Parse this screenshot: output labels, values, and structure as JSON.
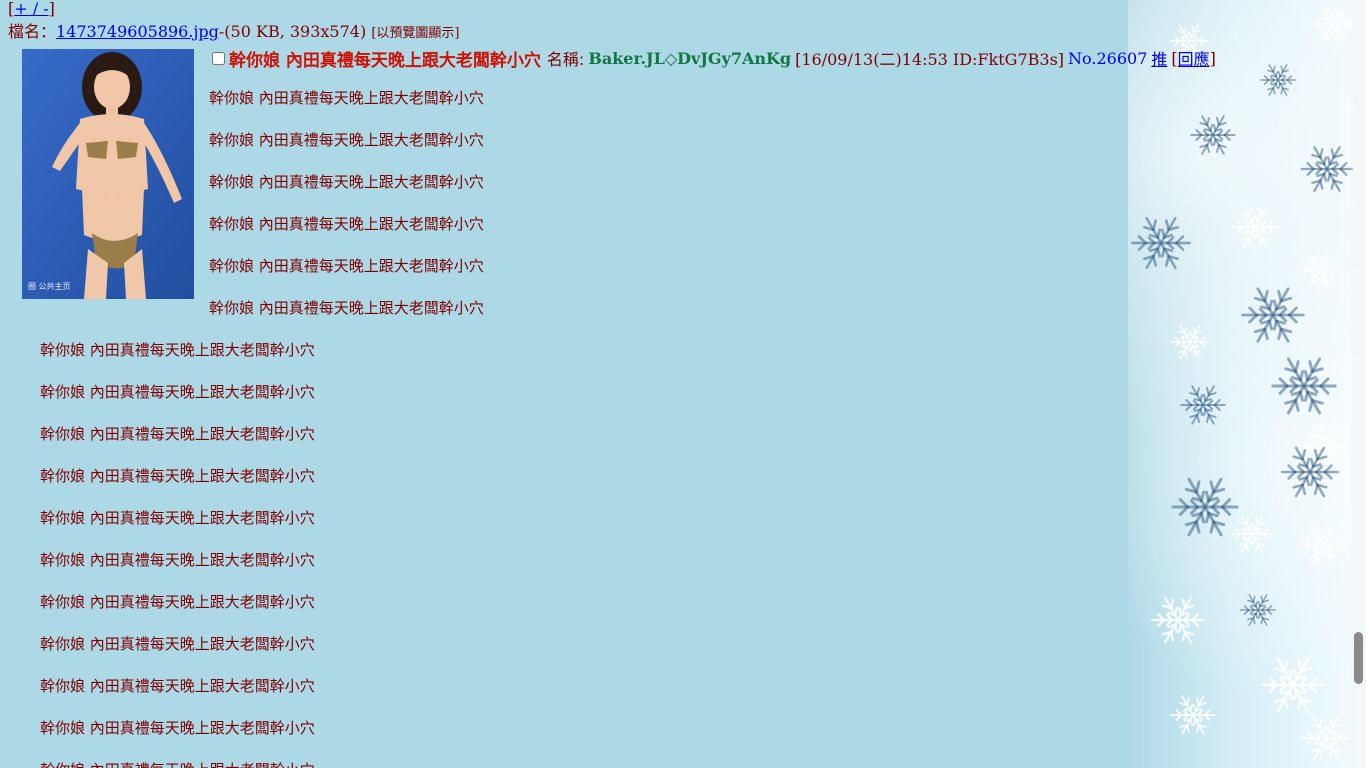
{
  "nav": {
    "toggle_open": "[",
    "toggle_link": "+ / -",
    "toggle_close": "]"
  },
  "file": {
    "label": "檔名：",
    "filename": "1473749605896.jpg",
    "info": "-(50 KB, 393x574)",
    "preview_note": "[以預覽圖顯示]"
  },
  "post": {
    "title": "幹你娘 內田真禮每天晚上跟大老闆幹小穴",
    "name_label": "名稱:",
    "poster_name": "Baker.JL◇DvJGy7AnKg",
    "meta": "[16/09/13(二)14:53 ID:FktG7B3s]",
    "number": "No.26607",
    "push_label": "推",
    "reply_open": "[",
    "reply_label": "回應",
    "reply_close": "]"
  },
  "body_lines": [
    "幹你娘 內田真禮每天晚上跟大老闆幹小穴",
    "幹你娘 內田真禮每天晚上跟大老闆幹小穴",
    "幹你娘 內田真禮每天晚上跟大老闆幹小穴",
    "幹你娘 內田真禮每天晚上跟大老闆幹小穴",
    "幹你娘 內田真禮每天晚上跟大老闆幹小穴",
    "幹你娘 內田真禮每天晚上跟大老闆幹小穴",
    "幹你娘 內田真禮每天晚上跟大老闆幹小穴",
    "幹你娘 內田真禮每天晚上跟大老闆幹小穴",
    "幹你娘 內田真禮每天晚上跟大老闆幹小穴",
    "幹你娘 內田真禮每天晚上跟大老闆幹小穴",
    "幹你娘 內田真禮每天晚上跟大老闆幹小穴",
    "幹你娘 內田真禮每天晚上跟大老闆幹小穴",
    "幹你娘 內田真禮每天晚上跟大老闆幹小穴",
    "幹你娘 內田真禮每天晚上跟大老闆幹小穴",
    "幹你娘 內田真禮每天晚上跟大老闆幹小穴",
    "幹你娘 內田真禮每天晚上跟大老闆幹小穴",
    "幹你娘 內田真禮每天晚上跟大老闆幹小穴"
  ],
  "thumbnail": {
    "watermark": "圈 公共主页"
  },
  "colors": {
    "page_bg": "#add8e6",
    "text": "#800000",
    "title": "#cc1105",
    "name": "#117743",
    "link": "#0000ee"
  }
}
